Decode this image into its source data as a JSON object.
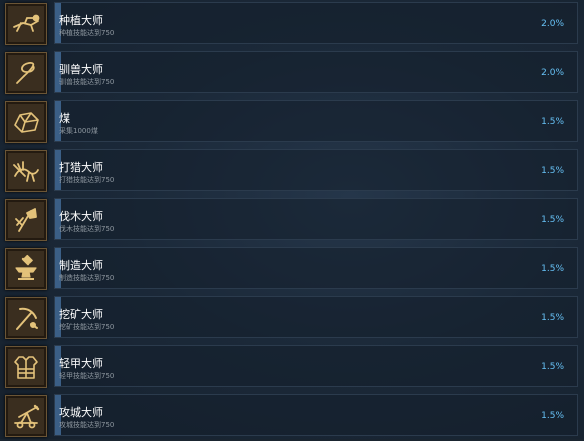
{
  "achievements": [
    {
      "icon": "plough-icon",
      "title": "种植大师",
      "description": "种植技能达到750",
      "percent": "2.0%"
    },
    {
      "icon": "whip-icon",
      "title": "驯兽大师",
      "description": "驯兽技能达到750",
      "percent": "2.0%"
    },
    {
      "icon": "coal-icon",
      "title": "煤",
      "description": "采集1000煤",
      "percent": "1.5%"
    },
    {
      "icon": "hunting-icon",
      "title": "打猎大师",
      "description": "打猎技能达到750",
      "percent": "1.5%"
    },
    {
      "icon": "axe-icon",
      "title": "伐木大师",
      "description": "伐木技能达到750",
      "percent": "1.5%"
    },
    {
      "icon": "anvil-icon",
      "title": "制造大师",
      "description": "制造技能达到750",
      "percent": "1.5%"
    },
    {
      "icon": "pickaxe-icon",
      "title": "挖矿大师",
      "description": "挖矿技能达到750",
      "percent": "1.5%"
    },
    {
      "icon": "armor-icon",
      "title": "轻甲大师",
      "description": "轻甲技能达到750",
      "percent": "1.5%"
    },
    {
      "icon": "catapult-icon",
      "title": "攻城大师",
      "description": "攻城技能达到750",
      "percent": "1.5%"
    }
  ],
  "colors": {
    "icon_gold": "#e3c27a",
    "percent": "#66c0f4",
    "progress": "#3b5f86"
  }
}
